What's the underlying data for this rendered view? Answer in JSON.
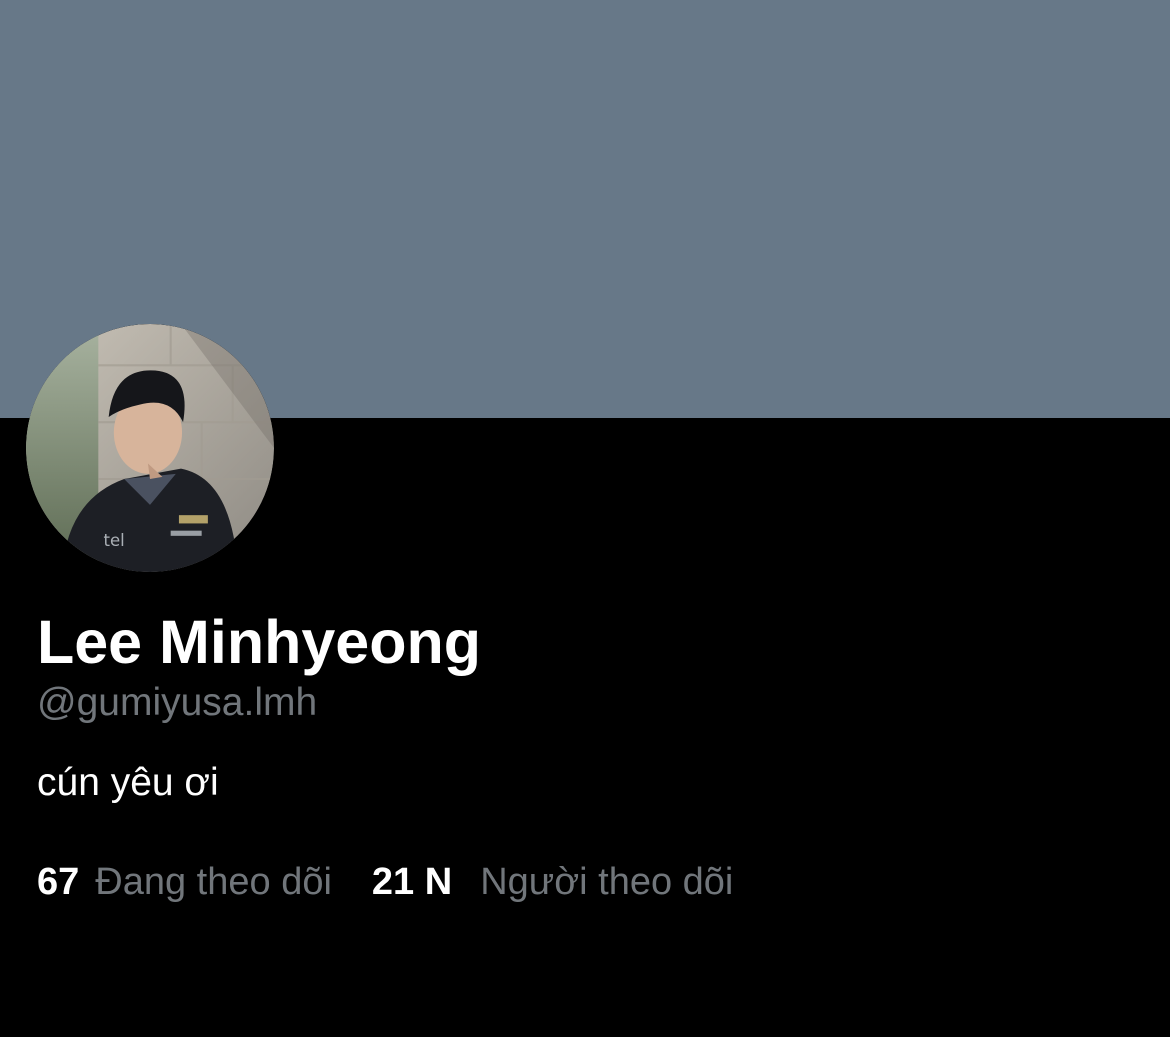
{
  "colors": {
    "banner": "#677888",
    "background": "#000000",
    "primary_text": "#ffffff",
    "secondary_text": "#71767b"
  },
  "profile": {
    "display_name": "Lee Minhyeong",
    "handle": "@gumiyusa.lmh",
    "bio": "cún yêu ơi",
    "avatar_icon": "profile-photo"
  },
  "stats": {
    "following": {
      "count": "67",
      "label": "Đang theo dõi"
    },
    "followers": {
      "count": "21 N",
      "label": "Người theo dõi"
    }
  }
}
